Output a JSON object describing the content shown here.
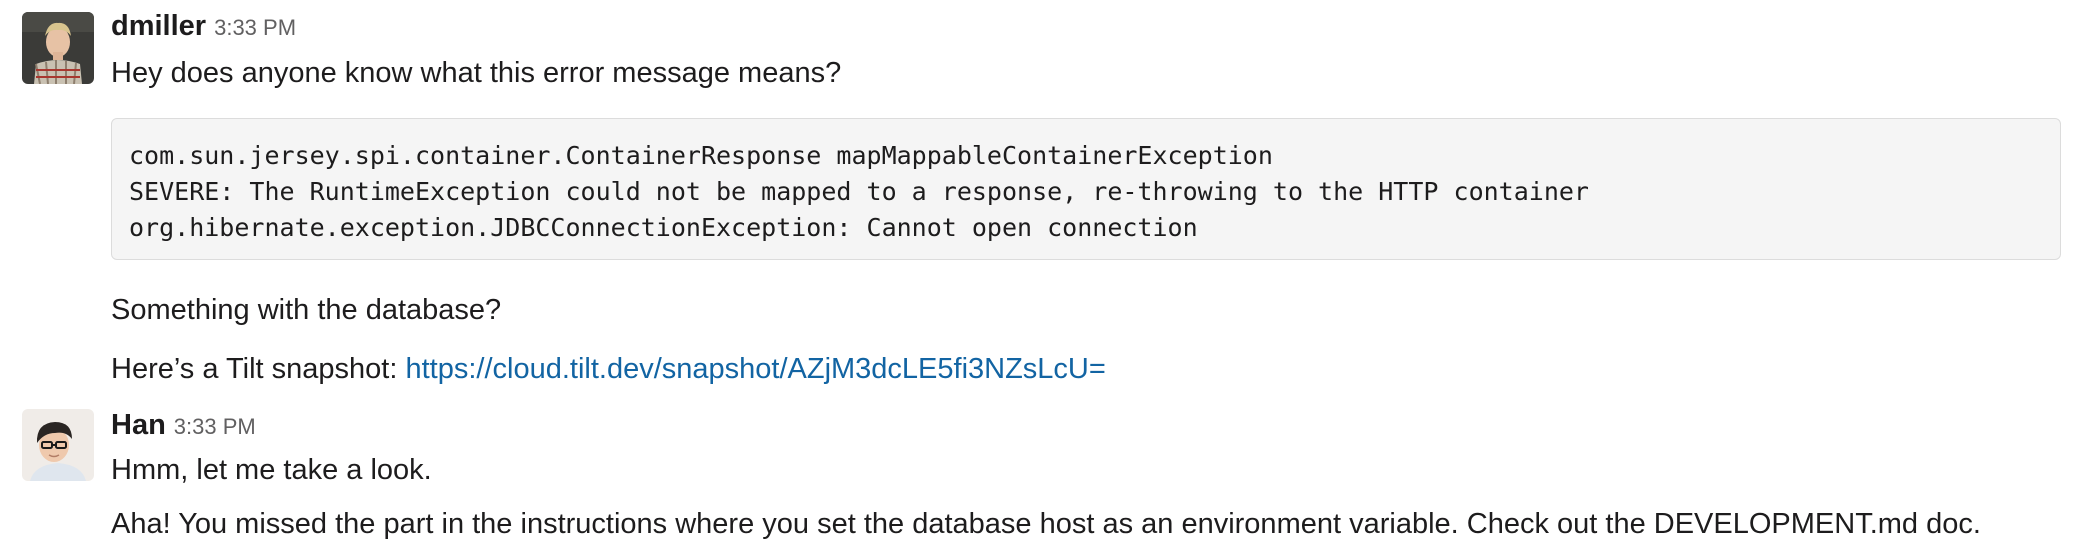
{
  "messages": [
    {
      "author": "dmiller",
      "time": "3:33 PM",
      "avatar": "avatar-dmiller",
      "text1": "Hey does anyone know what this error message means?",
      "code_lines": [
        "com.sun.jersey.spi.container.ContainerResponse mapMappableContainerException",
        "SEVERE: The RuntimeException could not be mapped to a response, re-throwing to the HTTP container",
        "org.hibernate.exception.JDBCConnectionException: Cannot open connection"
      ],
      "text2": "Something with the database?",
      "text3_prefix": "Here’s a Tilt snapshot:",
      "link": "https://cloud.tilt.dev/snapshot/AZjM3dcLE5fi3NZsLcU="
    },
    {
      "author": "Han",
      "time": "3:33 PM",
      "avatar": "avatar-han",
      "text1": "Hmm, let me take a look.",
      "text2": "Aha! You missed the part in the instructions where you set the database host as an environment variable. Check out the DEVELOPMENT.md doc."
    }
  ],
  "colors": {
    "link": "#1264a3",
    "text": "#1d1c1d",
    "timestamp": "#616061",
    "code_bg": "#f5f5f5"
  }
}
